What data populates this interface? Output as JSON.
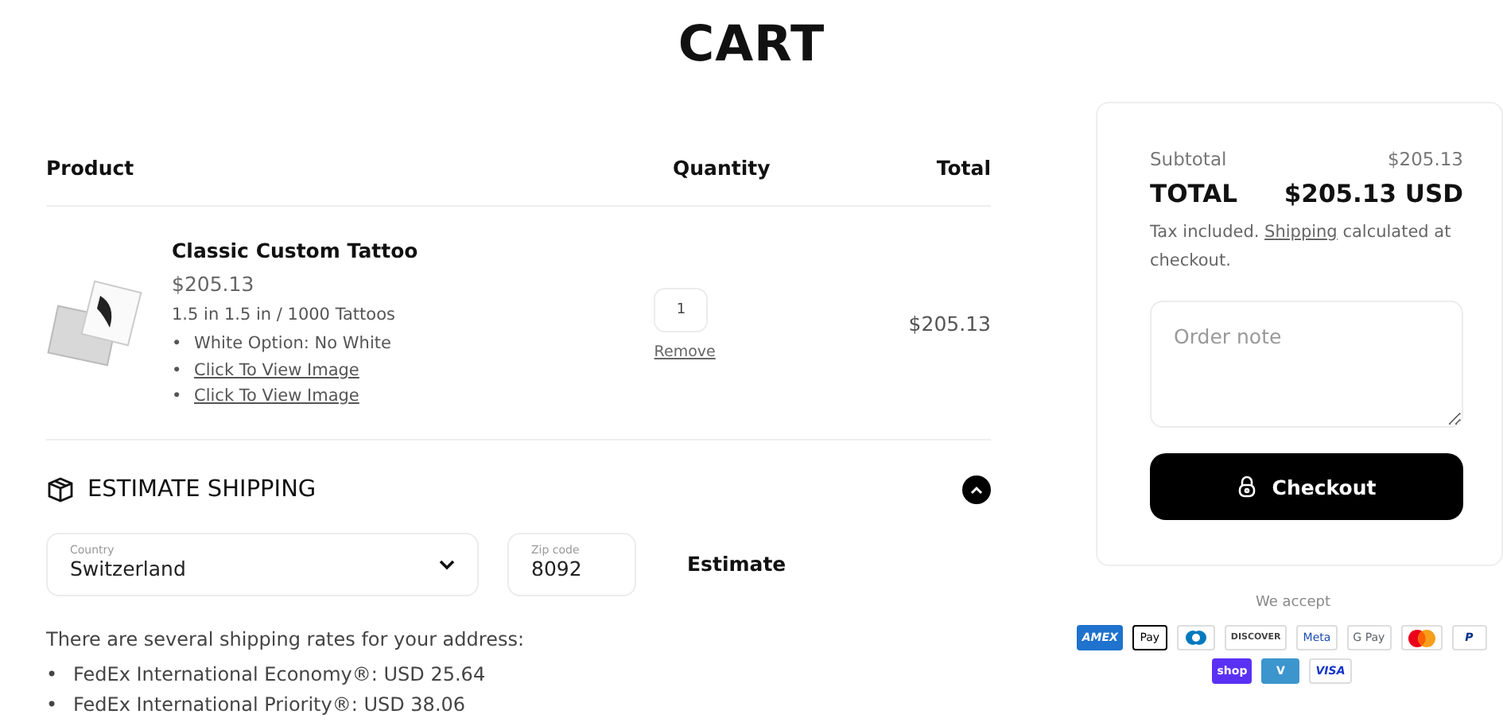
{
  "title": "CART",
  "table": {
    "columns": [
      "Product",
      "Quantity",
      "Total"
    ],
    "rows": [
      {
        "name": "Classic Custom Tattoo",
        "price": "$205.13",
        "variant": "1.5 in 1.5 in / 1000 Tattoos",
        "properties": [
          {
            "kind": "text",
            "bullet": "•",
            "text": "White Option: No White"
          },
          {
            "kind": "link",
            "bullet": "•",
            "text": "Click To View Image"
          },
          {
            "kind": "link",
            "bullet": "•",
            "text": "Click To View Image"
          }
        ],
        "quantity": "1",
        "remove": "Remove",
        "total": "$205.13"
      }
    ]
  },
  "shipping": {
    "title": "ESTIMATE SHIPPING",
    "expanded": true,
    "country": {
      "label": "Country",
      "value": "Switzerland"
    },
    "zip": {
      "label": "Zip code",
      "value": "8092"
    },
    "button": "Estimate",
    "message": "There are several shipping rates for your address:",
    "rates": [
      {
        "bullet": "•",
        "text": "FedEx International Economy®: USD 25.64"
      },
      {
        "bullet": "•",
        "text": "FedEx International Priority®: USD 38.06"
      }
    ]
  },
  "summary": {
    "subtotal_label": "Subtotal",
    "subtotal": "$205.13",
    "total_label": "TOTAL",
    "total": "$205.13 USD",
    "tax_before": "Tax included.",
    "tax_link": "Shipping",
    "tax_after": "calculated at checkout.",
    "note_placeholder": "Order note",
    "checkout": "Checkout"
  },
  "payments": {
    "title": "We accept",
    "methods": [
      {
        "kind": "amex",
        "label": "AMEX"
      },
      {
        "kind": "applepay",
        "label": "Pay"
      },
      {
        "kind": "diners"
      },
      {
        "kind": "discover",
        "label": "DISCOVER"
      },
      {
        "kind": "meta",
        "label": "Meta"
      },
      {
        "kind": "gpay",
        "label": "G Pay"
      },
      {
        "kind": "mastercard"
      },
      {
        "kind": "paypal",
        "label": "P"
      },
      {
        "kind": "shop",
        "label": "shop"
      },
      {
        "kind": "venmo",
        "label": "V"
      },
      {
        "kind": "visa",
        "label": "VISA"
      }
    ]
  }
}
